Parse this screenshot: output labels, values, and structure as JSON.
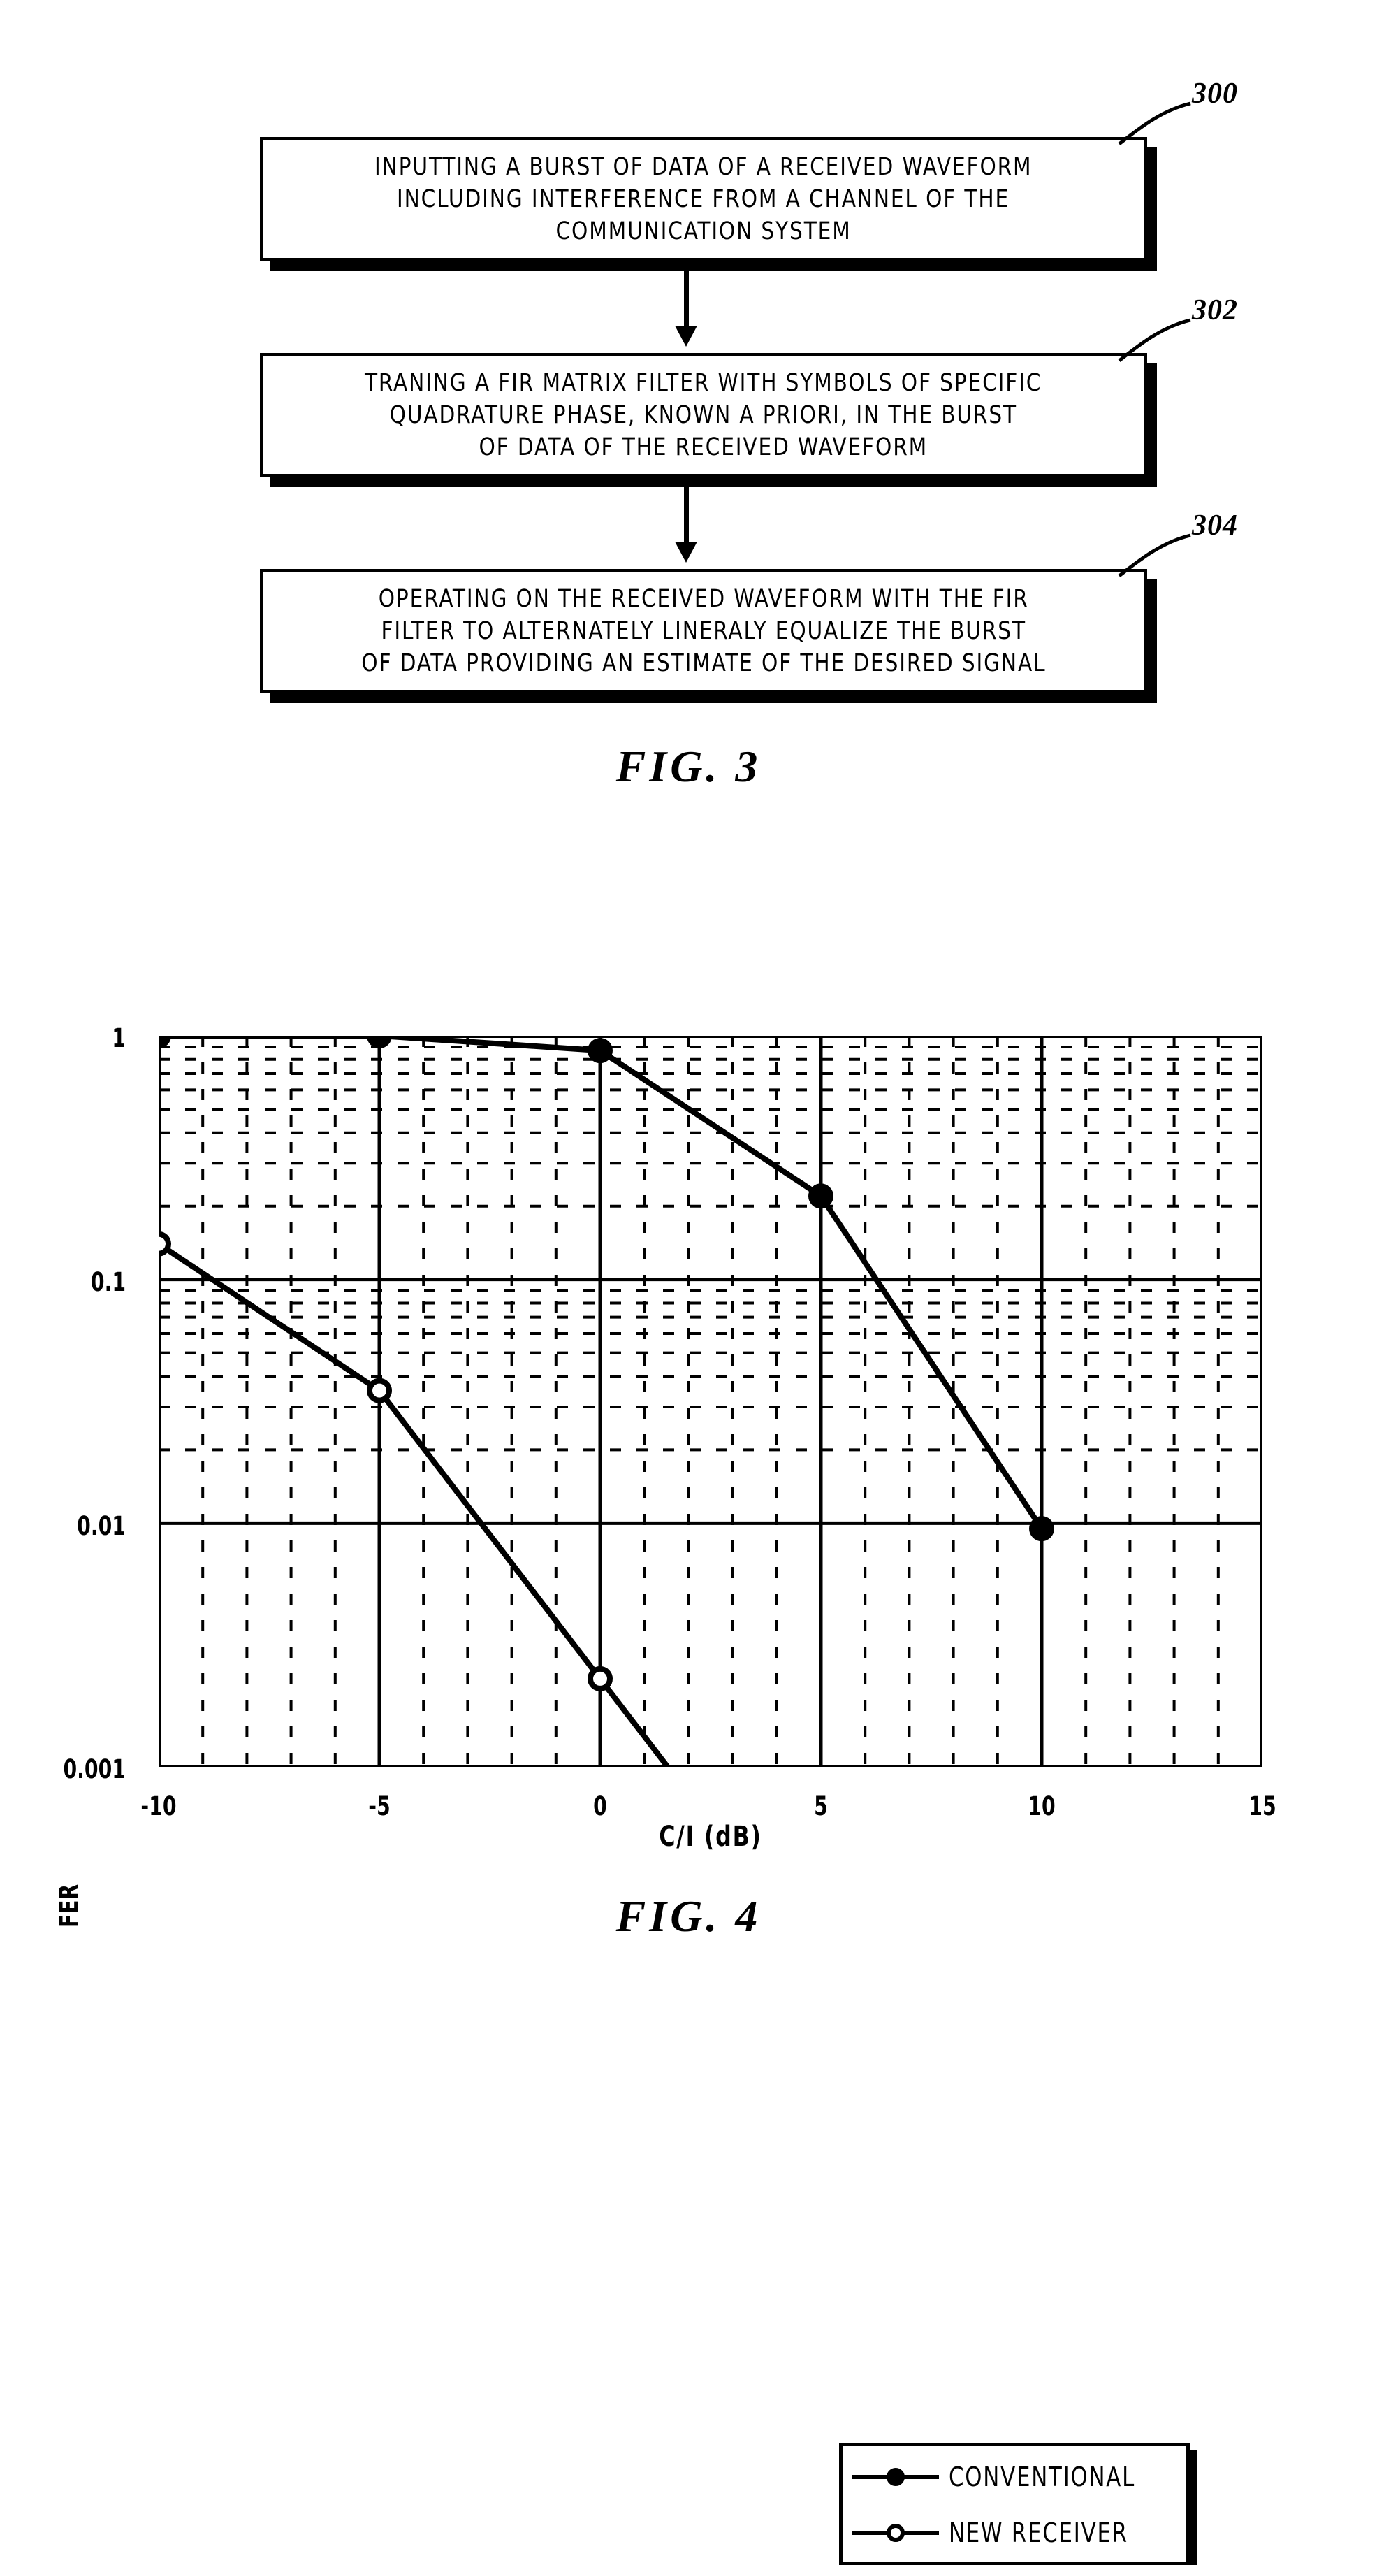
{
  "figure3": {
    "caption": "FIG. 3",
    "steps": [
      {
        "ref": "300",
        "lines": [
          "INPUTTING A BURST OF DATA OF A RECEIVED WAVEFORM",
          "INCLUDING INTERFERENCE FROM A CHANNEL OF THE",
          "COMMUNICATION SYSTEM"
        ]
      },
      {
        "ref": "302",
        "lines": [
          "TRANING A FIR MATRIX FILTER WITH SYMBOLS OF SPECIFIC",
          "QUADRATURE PHASE, KNOWN A PRIORI, IN THE BURST",
          "OF DATA OF THE RECEIVED WAVEFORM"
        ]
      },
      {
        "ref": "304",
        "lines": [
          "OPERATING ON THE RECEIVED WAVEFORM WITH THE FIR",
          "FILTER TO ALTERNATELY LINERALY EQUALIZE THE BURST",
          "OF DATA PROVIDING AN ESTIMATE OF THE DESIRED SIGNAL"
        ]
      }
    ]
  },
  "figure4": {
    "caption": "FIG. 4"
  },
  "chart_data": {
    "type": "line",
    "title": "",
    "xlabel": "C/I (dB)",
    "ylabel": "FER",
    "xlim": [
      -10,
      15
    ],
    "ylim": [
      0.001,
      1
    ],
    "yscale": "log",
    "xscale": "linear",
    "xticks": [
      -10,
      -5,
      0,
      5,
      10,
      15
    ],
    "xtick_labels": [
      "-10",
      "-5",
      "0",
      "5",
      "10",
      "15"
    ],
    "yticks": [
      1,
      0.1,
      0.01,
      0.001
    ],
    "ytick_labels": [
      "1",
      "0.1",
      "0.01",
      "0.001"
    ],
    "grid": "major and minor, dashed",
    "legend_position": "lower right",
    "series": [
      {
        "name": "CONVENTIONAL",
        "marker": "filled-circle",
        "x": [
          -10,
          -5,
          0,
          5,
          10
        ],
        "y": [
          1.0,
          1.0,
          0.87,
          0.22,
          0.0095
        ]
      },
      {
        "name": "NEW RECEIVER",
        "marker": "open-circle",
        "x": [
          -10,
          -5,
          0
        ],
        "y": [
          0.14,
          0.035,
          0.0023
        ],
        "note": "line continues below 0.001 past x=0"
      }
    ]
  }
}
